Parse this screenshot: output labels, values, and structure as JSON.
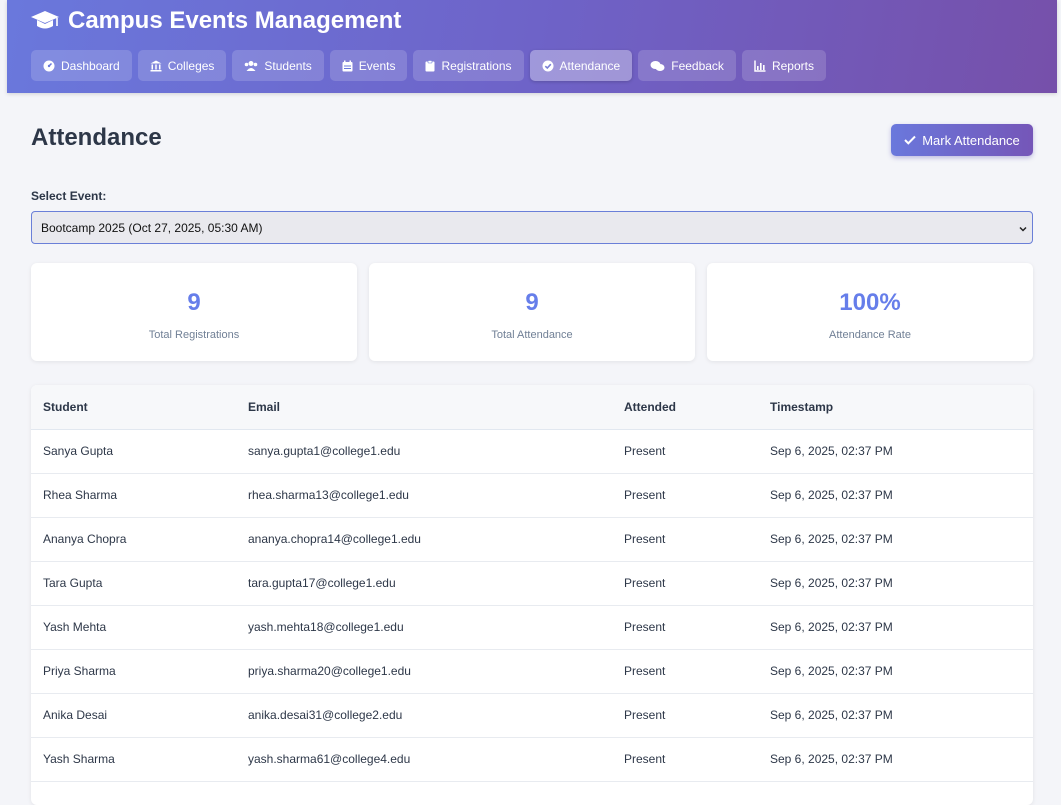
{
  "app": {
    "title": "Campus Events Management",
    "logo_icon": "graduation-cap-icon"
  },
  "nav": [
    {
      "label": "Dashboard",
      "icon": "dashboard-icon",
      "active": false
    },
    {
      "label": "Colleges",
      "icon": "university-icon",
      "active": false
    },
    {
      "label": "Students",
      "icon": "users-icon",
      "active": false
    },
    {
      "label": "Events",
      "icon": "calendar-icon",
      "active": false
    },
    {
      "label": "Registrations",
      "icon": "clipboard-icon",
      "active": false
    },
    {
      "label": "Attendance",
      "icon": "check-circle-icon",
      "active": true
    },
    {
      "label": "Feedback",
      "icon": "comments-icon",
      "active": false
    },
    {
      "label": "Reports",
      "icon": "chart-icon",
      "active": false
    }
  ],
  "page": {
    "title": "Attendance",
    "mark_button": "Mark Attendance",
    "select_label": "Select Event:",
    "selected_event": "Bootcamp 2025 (Oct 27, 2025, 05:30 AM)"
  },
  "stats": [
    {
      "value": "9",
      "label": "Total Registrations"
    },
    {
      "value": "9",
      "label": "Total Attendance"
    },
    {
      "value": "100%",
      "label": "Attendance Rate"
    }
  ],
  "table": {
    "headers": [
      "Student",
      "Email",
      "Attended",
      "Timestamp"
    ],
    "rows": [
      [
        "Sanya Gupta",
        "sanya.gupta1@college1.edu",
        "Present",
        "Sep 6, 2025, 02:37 PM"
      ],
      [
        "Rhea Sharma",
        "rhea.sharma13@college1.edu",
        "Present",
        "Sep 6, 2025, 02:37 PM"
      ],
      [
        "Ananya Chopra",
        "ananya.chopra14@college1.edu",
        "Present",
        "Sep 6, 2025, 02:37 PM"
      ],
      [
        "Tara Gupta",
        "tara.gupta17@college1.edu",
        "Present",
        "Sep 6, 2025, 02:37 PM"
      ],
      [
        "Yash Mehta",
        "yash.mehta18@college1.edu",
        "Present",
        "Sep 6, 2025, 02:37 PM"
      ],
      [
        "Priya Sharma",
        "priya.sharma20@college1.edu",
        "Present",
        "Sep 6, 2025, 02:37 PM"
      ],
      [
        "Anika Desai",
        "anika.desai31@college2.edu",
        "Present",
        "Sep 6, 2025, 02:37 PM"
      ],
      [
        "Yash Sharma",
        "yash.sharma61@college4.edu",
        "Present",
        "Sep 6, 2025, 02:37 PM"
      ]
    ]
  },
  "colors": {
    "accent": "#667eea",
    "header_gradient_start": "#6a78dc",
    "header_gradient_end": "#7650aa"
  }
}
